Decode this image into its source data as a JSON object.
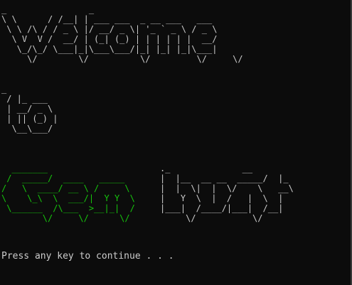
{
  "console": {
    "banner_welcome": "_                _                             \n\\ \\      / /__| | ___ ___  _ __ ___   ___ \n \\ \\ /\\ / / _ \\ |/ __/ _ \\| '_ ` _ \\ / _ \\\n  \\ V  V /  __/ | (_| (_) | | | | | |  __/\n   \\_/\\_/ \\___|_|\\___\\___/|_| |_| |_|\\___|\n     \\/        \\/          \\/         \\/     \\/",
    "banner_to": "_\n / |_ ___\n | __/ _ \\\n | || (_) |\n  \\__\\___/",
    "banner_gem": "  _______\n /  _____/  ____   _____\n/   \\  ____/ __ \\ /     \\\n\\    \\_\\  \\  ___/|  Y Y  \\\n \\______  /\\___  >__|_|  /\n        \\/     \\/      \\/",
    "banner_hunt": "._              __\n|  |__  __ __  _____/  |_\n|  |  \\|  |  \\/    \\   __\\\n|   Y  \\  |  /   |  \\  |\n|___|  /____/|___|  /__|\n     \\/           \\/",
    "prompt_text": "Press any key to continue . . ."
  },
  "colors": {
    "background": "#0c0c0c",
    "text": "#cccccc",
    "accent_green": "#16c60c"
  }
}
